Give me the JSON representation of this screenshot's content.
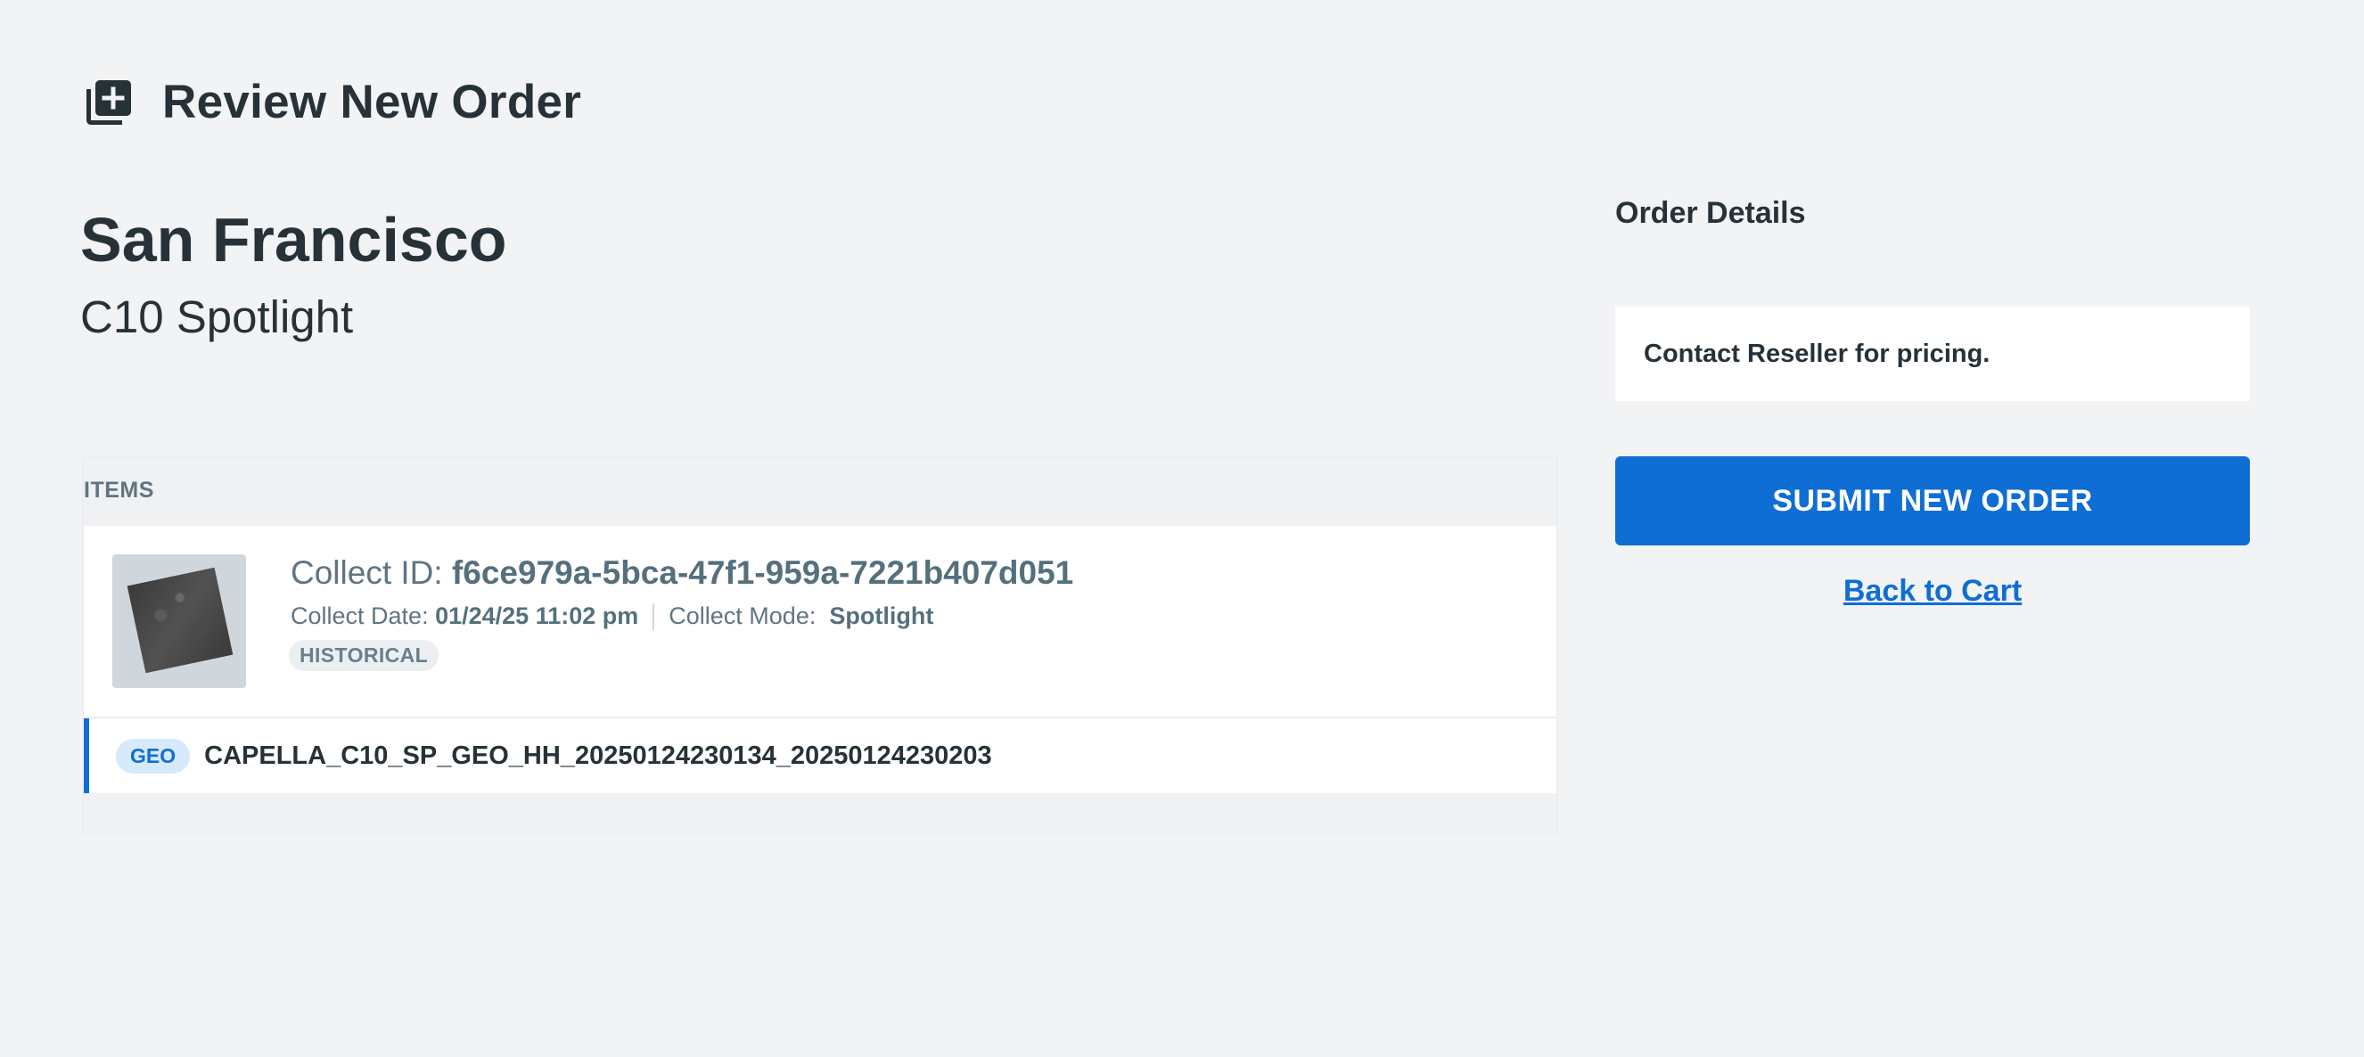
{
  "header": {
    "title": "Review New Order",
    "icon": "add-to-queue-icon"
  },
  "location": {
    "name": "San Francisco",
    "subtitle": "C10 Spotlight"
  },
  "items": {
    "section_label": "ITEMS",
    "collect": {
      "id_label": "Collect ID:",
      "id_value": "f6ce979a-5bca-47f1-959a-7221b407d051",
      "date_label": "Collect Date:",
      "date_value": "01/24/25 11:02 pm",
      "mode_label": "Collect Mode:",
      "mode_value": "Spotlight",
      "badge": "HISTORICAL"
    },
    "product": {
      "type_badge": "GEO",
      "name": "CAPELLA_C10_SP_GEO_HH_20250124230134_20250124230203"
    }
  },
  "order_details": {
    "title": "Order Details",
    "pricing_note": "Contact Reseller for pricing.",
    "submit_label": "SUBMIT NEW ORDER",
    "back_link": "Back to Cart"
  },
  "colors": {
    "background": "#f2f3f5",
    "accent": "#0f6ed4",
    "text_dark": "#263238",
    "text_muted": "#5f7581"
  }
}
